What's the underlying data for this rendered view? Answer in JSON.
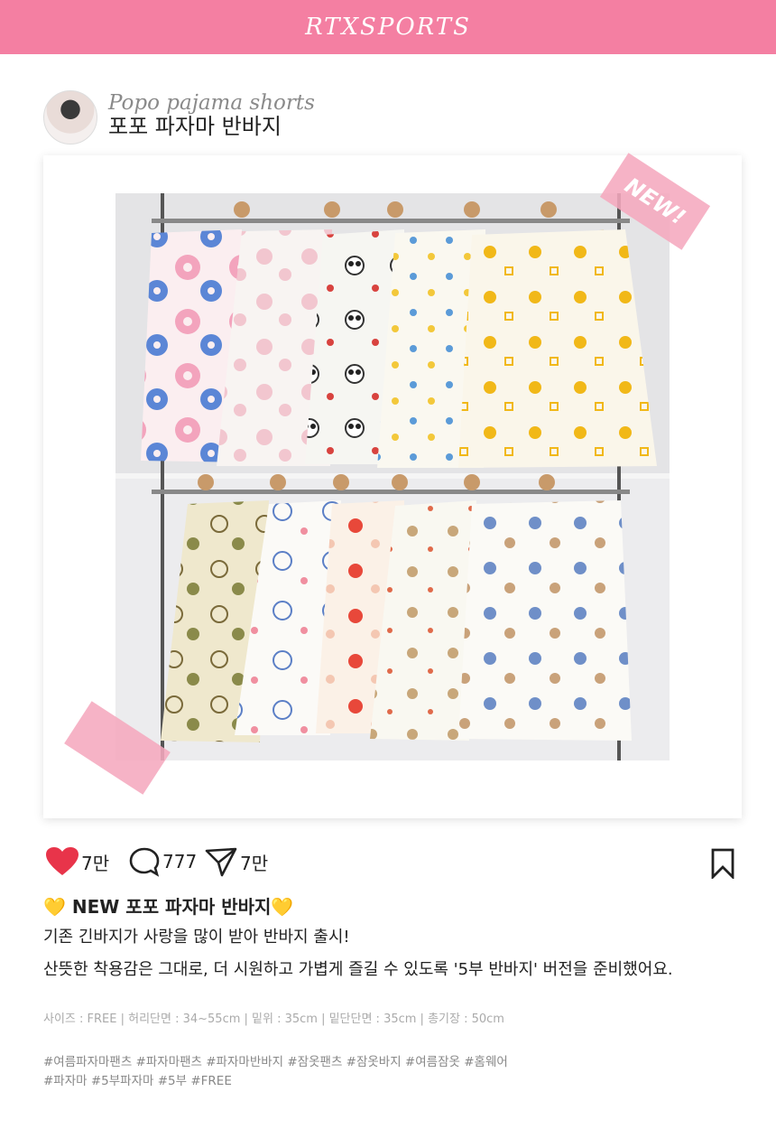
{
  "header": {
    "brand": "RTXSPORTS"
  },
  "profile": {
    "english_name": "Popo pajama shorts",
    "korean_name": "포포 파자마 반바지"
  },
  "badge": {
    "text": "NEW!"
  },
  "actions": {
    "likes": "7만",
    "comments": "777",
    "shares": "7만",
    "like_icon": "heart-icon",
    "comment_icon": "comment-bubble-icon",
    "share_icon": "send-icon",
    "bookmark_icon": "bookmark-icon"
  },
  "post": {
    "title": "💛 NEW 포포 파자마 반바지💛",
    "line1": "기존 긴바지가 사랑을 많이 받아 반바지 출시!",
    "line2": "산뜻한 착용감은 그대로, 더 시원하고 가볍게 즐길 수 있도록 '5부 반바지' 버전을 준비했어요."
  },
  "specs": "사이즈 : FREE  |  허리단면 : 34~55cm  |  밑위 : 35cm  |  밑단단면 : 35cm  |  총기장 : 50cm",
  "hashtags": {
    "line1": "#여름파자마팬츠 #파자마팬츠 #파자마반바지 #잠옷팬츠 #잠옷바지 #여름잠옷 #홈웨어",
    "line2": "#파자마 #5부파자마 #5부 #FREE"
  },
  "colors": {
    "topbar": "#f47fa2",
    "heart": "#e8344a",
    "tape": "#f5a8be"
  }
}
